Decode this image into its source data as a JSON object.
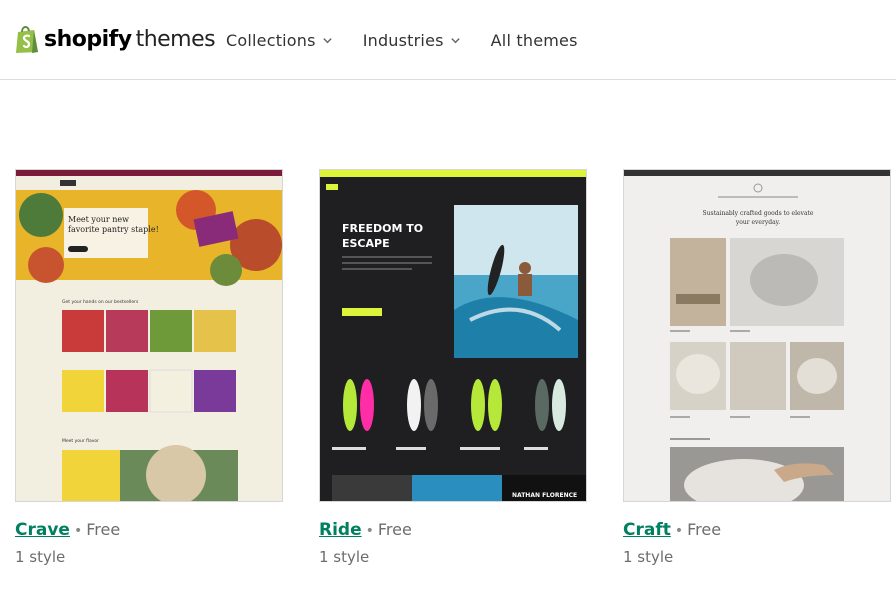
{
  "header": {
    "logo_word": "shopify",
    "logo_sub": "themes",
    "nav": [
      {
        "label": "Collections",
        "has_dropdown": true
      },
      {
        "label": "Industries",
        "has_dropdown": true
      },
      {
        "label": "All themes",
        "has_dropdown": false
      }
    ]
  },
  "colors": {
    "brand_green": "#95bf47",
    "link_green": "#008060",
    "muted_text": "#6d6d6d"
  },
  "themes": [
    {
      "name": "Crave",
      "price": "Free",
      "styles": "1 style",
      "preview": {
        "hero_heading": "Meet your new favorite pantry staple!",
        "section_1": "Get your hands on our bestsellers",
        "section_2": "Meet your flavor"
      }
    },
    {
      "name": "Ride",
      "price": "Free",
      "styles": "1 style",
      "preview": {
        "hero_heading_line1": "FREEDOM TO",
        "hero_heading_line2": "ESCAPE",
        "banner_text": "NATHAN FLORENCE"
      }
    },
    {
      "name": "Craft",
      "price": "Free",
      "styles": "1 style",
      "preview": {
        "hero_heading_line1": "Sustainably crafted goods to elevate",
        "hero_heading_line2": "your everyday."
      }
    }
  ]
}
